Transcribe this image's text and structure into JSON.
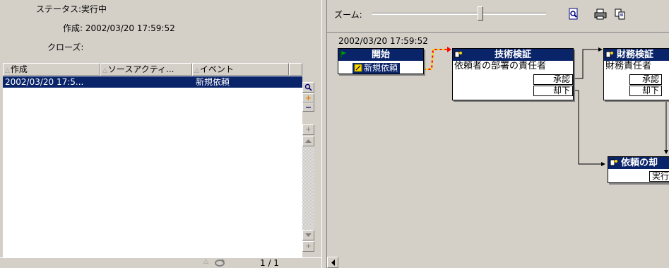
{
  "info": {
    "status_label": "ステータス:",
    "status_value": "実行中",
    "created_label": "作成:",
    "created_value": "2002/03/20 17:59:52",
    "closed_label": "クローズ:"
  },
  "list": {
    "columns": [
      "作成",
      "ソースアクティ...",
      "イベント"
    ],
    "rows": [
      {
        "created": "2002/03/20 17:5...",
        "source": "",
        "event": "新規依頼"
      }
    ],
    "page_indicator": "1 / 1"
  },
  "toolbar": {
    "zoom_label": "ズーム:",
    "zoom_level": 0.62,
    "icons": [
      "zoom-preview-icon",
      "print-icon",
      "copy-icon"
    ]
  },
  "workflow": {
    "timestamp": "2002/03/20 17:59:52",
    "nodes": {
      "start": {
        "title": "開始",
        "event": "新規依頼"
      },
      "tech": {
        "title": "技術検証",
        "body": "依頼者の部署の責任者",
        "outcomes": [
          "承認",
          "却下"
        ]
      },
      "finance": {
        "title": "財務検証",
        "body": "財務責任者",
        "outcomes": [
          "承認",
          "却下"
        ]
      },
      "request": {
        "title": "依頼の却",
        "status": "実行"
      }
    },
    "colors": {
      "title_bg": "#0a246a",
      "active_link": "#ff0000",
      "active_link2": "#ffd700"
    }
  }
}
